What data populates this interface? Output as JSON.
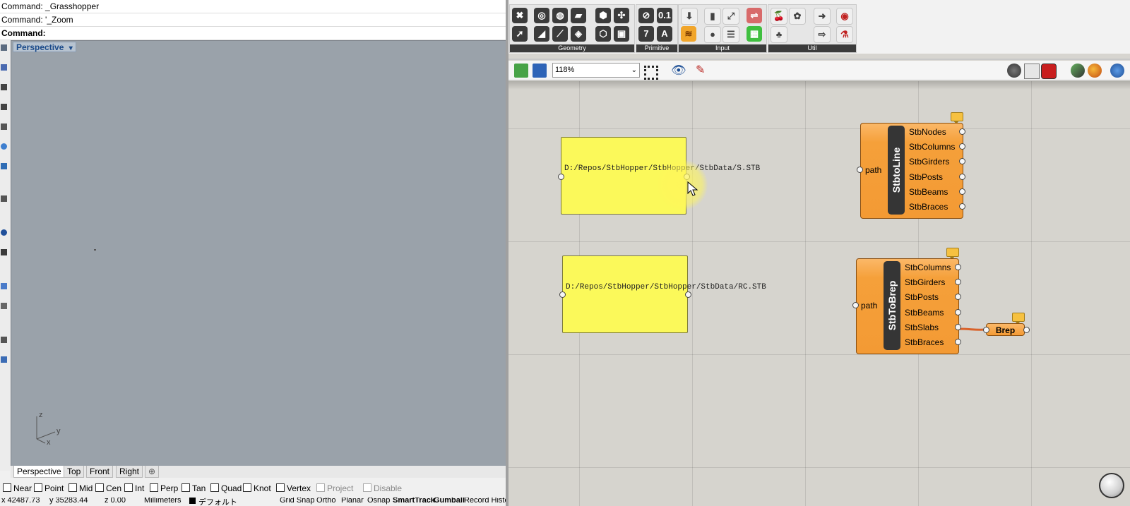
{
  "rhino": {
    "command_history": [
      "Command: _Grasshopper",
      "Command: '_Zoom"
    ],
    "command_prompt": "Command:",
    "viewport": {
      "title": "Perspective",
      "dropdown_glyph": "▾",
      "axis_z": "z",
      "axis_y": "y",
      "axis_x": "x"
    },
    "view_tabs": [
      "Perspective",
      "Top",
      "Front",
      "Right"
    ],
    "add_tab_glyph": "⊕",
    "osnaps": [
      {
        "label": "Near",
        "enabled": true
      },
      {
        "label": "Point",
        "enabled": true
      },
      {
        "label": "Mid",
        "enabled": true
      },
      {
        "label": "Cen",
        "enabled": true
      },
      {
        "label": "Int",
        "enabled": true
      },
      {
        "label": "Perp",
        "enabled": true
      },
      {
        "label": "Tan",
        "enabled": true
      },
      {
        "label": "Quad",
        "enabled": true
      },
      {
        "label": "Knot",
        "enabled": true
      },
      {
        "label": "Vertex",
        "enabled": true
      },
      {
        "label": "Project",
        "enabled": false
      },
      {
        "label": "Disable",
        "enabled": false
      }
    ],
    "status": {
      "x": "x 42487.73",
      "y": "y 35283.44",
      "z": "z 0.00",
      "units": "Millimeters",
      "layer": "デフォルト",
      "toggles": [
        "Grid Snap",
        "Ortho",
        "Planar",
        "Osnap",
        "SmartTrack",
        "Gumball",
        "Record History"
      ]
    }
  },
  "grasshopper": {
    "ribbon_panels": [
      "Geometry",
      "Primitive",
      "Input",
      "Util"
    ],
    "zoom": "118%",
    "panels": [
      {
        "text": "D:/Repos/StbHopper/StbHopper/StbData/S.STB"
      },
      {
        "text": "D:/Repos/StbHopper/StbHopper/StbData/RC.STB"
      }
    ],
    "components": [
      {
        "name": "StbtoLine",
        "input": "path",
        "outputs": [
          "StbNodes",
          "StbColumns",
          "StbGirders",
          "StbPosts",
          "StbBeams",
          "StbBraces"
        ]
      },
      {
        "name": "StbToBrep",
        "input": "path",
        "outputs": [
          "StbColumns",
          "StbGirders",
          "StbPosts",
          "StbBeams",
          "StbSlabs",
          "StbBraces"
        ]
      }
    ],
    "brep_param": "Brep",
    "colors": {
      "component": "#f39a34",
      "panel": "#fbf95a",
      "wire": "#d9622a",
      "canvas": "#d6d4ce"
    }
  }
}
